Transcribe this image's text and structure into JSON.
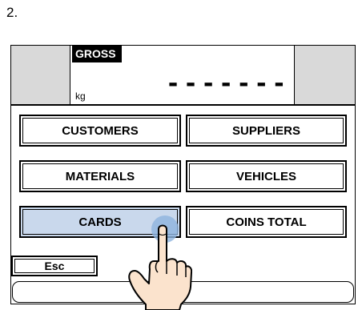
{
  "step_label": "2.",
  "display": {
    "gross_label": "GROSS",
    "unit": "kg",
    "value": "-------"
  },
  "buttons": {
    "customers": "CUSTOMERS",
    "suppliers": "SUPPLIERS",
    "materials": "MATERIALS",
    "vehicles": "VEHICLES",
    "cards": "CARDS",
    "coins_total": "COINS TOTAL"
  },
  "esc_label": "Esc",
  "colors": {
    "selected_button": "#c9d8ec",
    "touch_point": "#8fb4de",
    "header_side_panels": "#d9d9d9"
  },
  "icons": {
    "pointer": "hand-pointer-icon"
  }
}
